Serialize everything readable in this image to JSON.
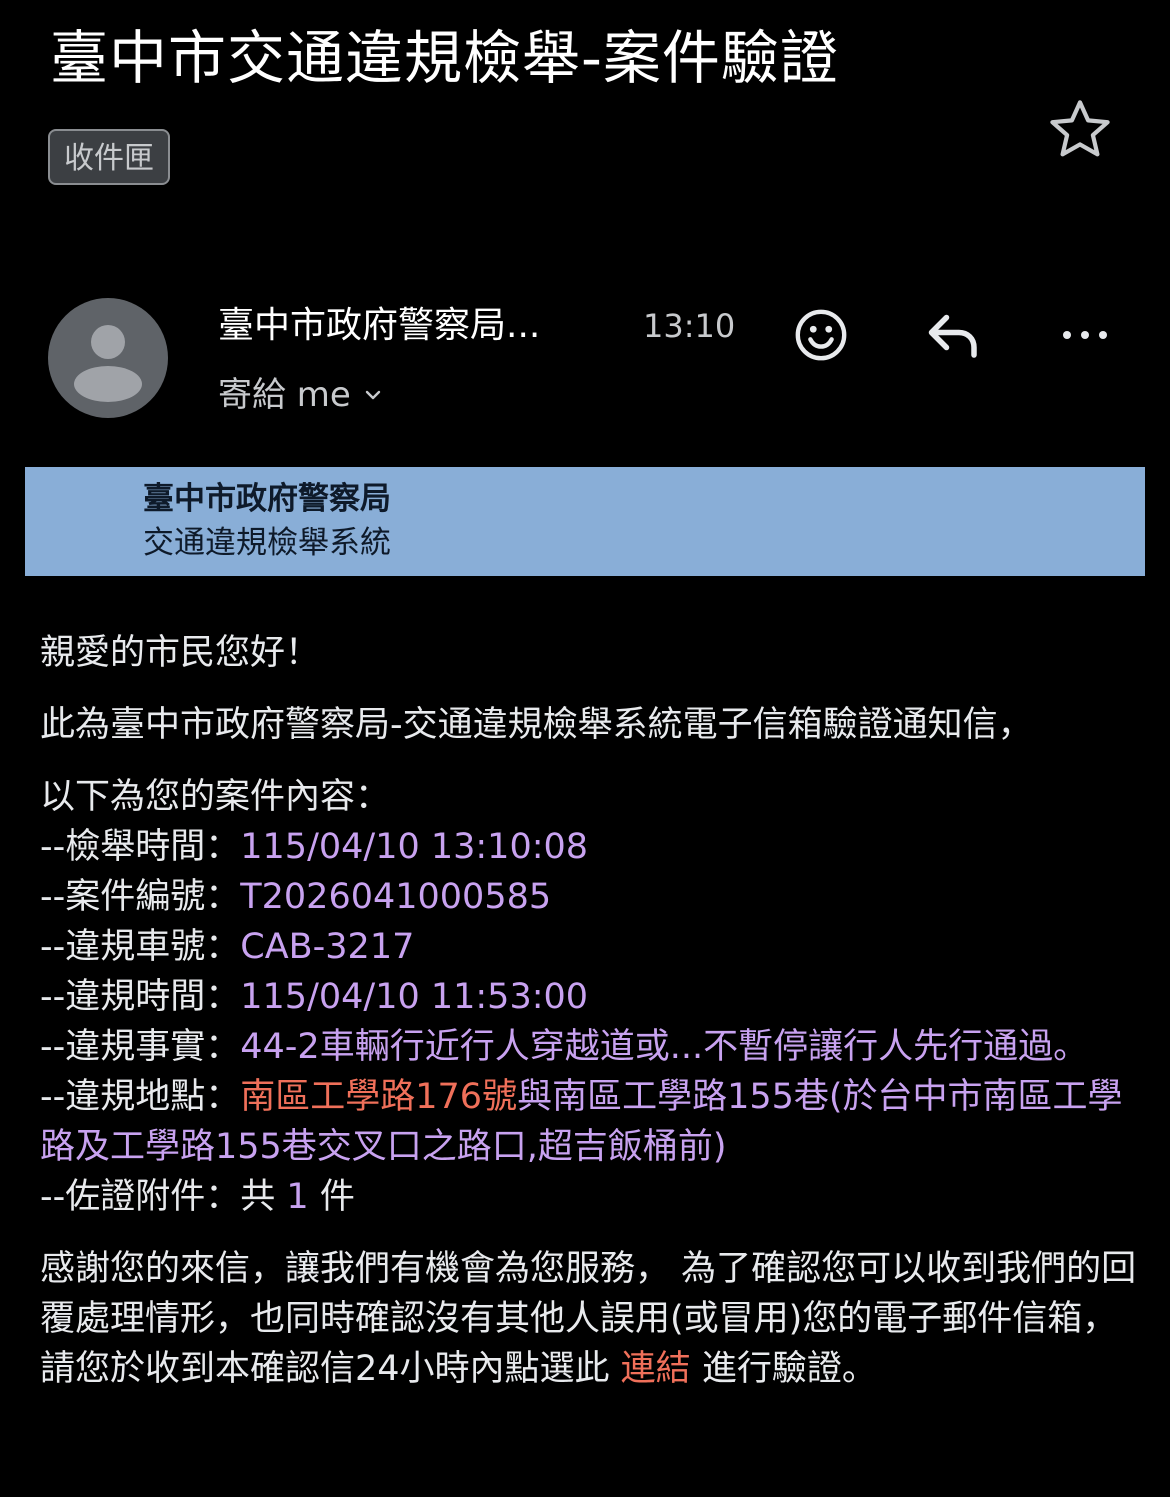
{
  "header": {
    "subject": "臺中市交通違規檢舉-案件驗證",
    "label": "收件匣"
  },
  "message": {
    "sender": "臺中市政府警察局...",
    "time": "13:10",
    "recipient": "寄給 me"
  },
  "banner": {
    "line1": "臺中市政府警察局",
    "line2": "交通違規檢舉系統"
  },
  "content": {
    "greeting": "親愛的市民您好！",
    "intro": "此為臺中市政府警察局-交通違規檢舉系統電子信箱驗證通知信，",
    "list_title": "以下為您的案件內容：",
    "rows": [
      {
        "label": "--檢舉時間：",
        "value": "115/04/10 13:10:08"
      },
      {
        "label": "--案件編號：",
        "value": "T2026041000585"
      },
      {
        "label": "--違規車號：",
        "value": "CAB-3217"
      },
      {
        "label": "--違規時間：",
        "value": "115/04/10 11:53:00"
      },
      {
        "label": "--違規事實：",
        "value": "44-2車輛行近行人穿越道或...不暫停讓行人先行通過。"
      }
    ],
    "location_label": "--違規地點：",
    "location_highlight": "南區工學路176號",
    "location_rest": "與南區工學路155巷(於台中市南區工學路及工學路155巷交叉口之路口,超吉飯桶前)",
    "attachments_label": "--佐證附件：",
    "attachments_pre": "共 ",
    "attachments_count": "1",
    "attachments_post": " 件",
    "closing_pre": "感謝您的來信，讓我們有機會為您服務， 為了確認您可以收到我們的回覆處理情形，也同時確認沒有其他人誤用(或冒用)您的電子郵件信箱， 請您於收到本確認信24小時內點選此 ",
    "closing_link": "連結",
    "closing_post": " 進行驗證。"
  },
  "colors": {
    "background": "#000000",
    "banner": "#89aed7",
    "value_purple": "#c8a2f0",
    "link_red": "#f0705a"
  },
  "icons": {
    "star": "star-outline-icon",
    "avatar": "person-avatar-icon",
    "smile": "emoji-smile-icon",
    "reply": "reply-icon",
    "more": "more-horizontal-icon",
    "chevron": "chevron-down-icon"
  }
}
